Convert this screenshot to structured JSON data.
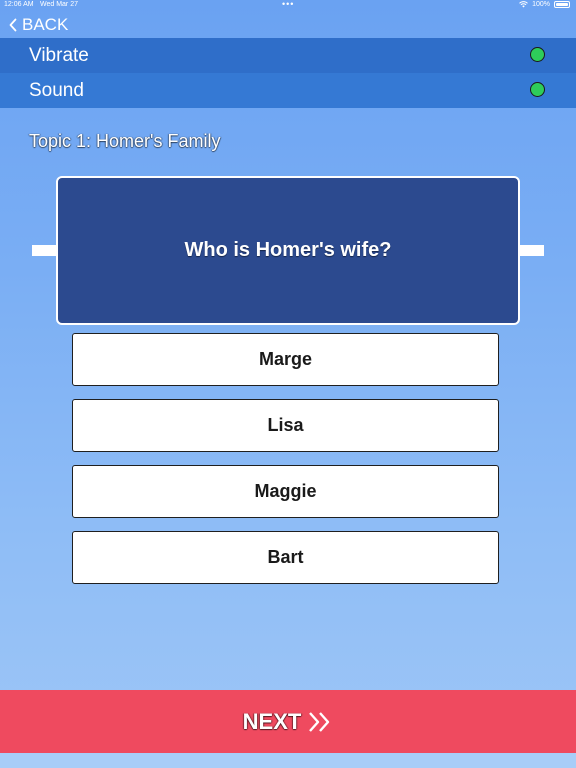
{
  "status_bar": {
    "time": "12:06 AM",
    "date": "Wed Mar 27",
    "dots": "•••",
    "battery": "100%",
    "icons": [
      "wifi-icon",
      "battery-icon"
    ]
  },
  "nav": {
    "back_label": "BACK",
    "back_icon": "chevron-left-icon"
  },
  "settings": {
    "items": [
      {
        "label": "Vibrate",
        "status_color": "#2ecc5a"
      },
      {
        "label": "Sound",
        "status_color": "#2ecc5a"
      }
    ]
  },
  "quiz": {
    "topic": "Topic 1: Homer's Family",
    "question": "Who is Homer's wife?",
    "answers": [
      "Marge",
      "Lisa",
      "Maggie",
      "Bart"
    ]
  },
  "footer": {
    "next_label": "NEXT",
    "next_icon": "double-chevron-right-icon"
  },
  "colors": {
    "header_panel": "#3274cf",
    "question_card": "#2c4a8f",
    "next_button": "#ef4a5f",
    "toggle_on": "#2ecc5a"
  }
}
